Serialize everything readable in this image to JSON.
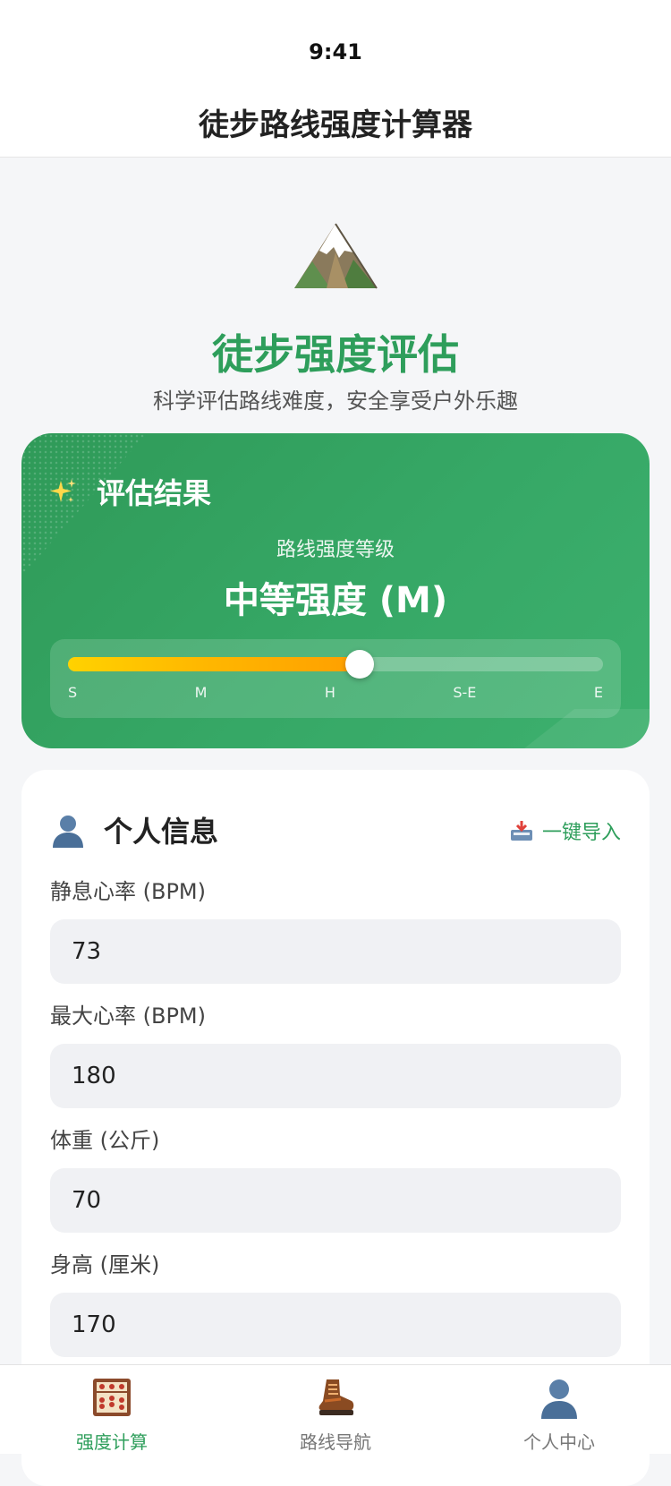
{
  "status_bar": {
    "time": "9:41"
  },
  "header": {
    "title": "徒步路线强度计算器"
  },
  "hero": {
    "icon": "mountain-icon",
    "title": "徒步强度评估",
    "subtitle": "科学评估路线难度，安全享受户外乐趣"
  },
  "result": {
    "title": "评估结果",
    "icon": "sparkles-icon",
    "level_caption": "路线强度等级",
    "level_value": "中等强度 (M)",
    "slider": {
      "value_fraction": 0.545,
      "labels": [
        "S",
        "M",
        "H",
        "S-E",
        "E"
      ]
    },
    "colors": {
      "card_start": "#2f9a58",
      "card_end": "#3db06e",
      "slider_fill_start": "#ffd200",
      "slider_fill_end": "#ff9f00"
    }
  },
  "personal": {
    "title": "个人信息",
    "icon": "person-icon",
    "import_label": "一键导入",
    "import_icon": "inbox-tray-icon",
    "fields": [
      {
        "label": "静息心率 (BPM)",
        "value": "73"
      },
      {
        "label": "最大心率 (BPM)",
        "value": "180"
      },
      {
        "label": "体重 (公斤)",
        "value": "70"
      },
      {
        "label": "身高 (厘米)",
        "value": "170"
      }
    ]
  },
  "tabs": [
    {
      "label": "强度计算",
      "icon": "abacus-icon",
      "active": true
    },
    {
      "label": "路线导航",
      "icon": "hiking-boot-icon",
      "active": false
    },
    {
      "label": "个人中心",
      "icon": "person-silhouette-icon",
      "active": false
    }
  ],
  "accent_color": "#2e9e5b"
}
